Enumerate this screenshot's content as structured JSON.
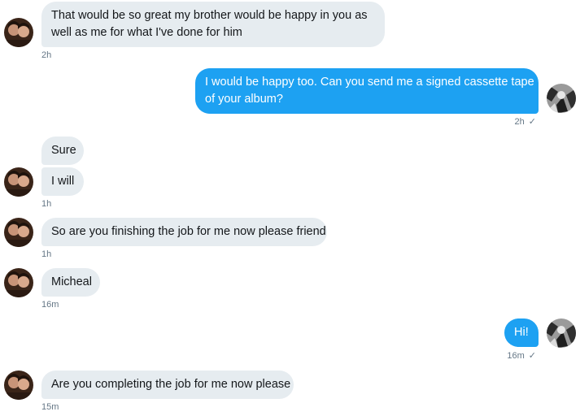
{
  "messages": [
    {
      "text_1": "That would be so great my brother would be happy in you as",
      "text_2": "well as me for what I've done for him",
      "time": "2h"
    },
    {
      "text_1": "I would be happy too. Can you send me a signed cassette tape",
      "text_2": "of your album?",
      "time": "2h",
      "check": "✓"
    },
    {
      "text": "Sure"
    },
    {
      "text": "I will",
      "time": "1h"
    },
    {
      "text": "So are you finishing the job for me now please friend",
      "time": "1h"
    },
    {
      "text": "Micheal",
      "time": "16m"
    },
    {
      "text": "Hi!",
      "time": "16m",
      "check": "✓"
    },
    {
      "text": "Are you completing the job for me now please",
      "time": "15m"
    }
  ],
  "colors": {
    "received_bubble": "#e6ecf0",
    "sent_bubble": "#1da1f2",
    "timestamp": "#657786"
  },
  "icons": {
    "contact_avatar": "two-people-photo",
    "user_avatar": "black-white-photo"
  }
}
